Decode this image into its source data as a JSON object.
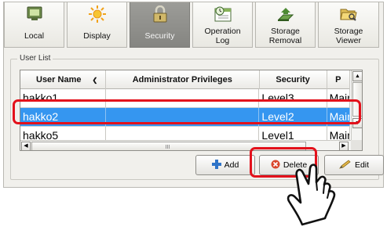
{
  "tabs": [
    {
      "label": "Local",
      "icon": "local-icon",
      "active": false
    },
    {
      "label": "Display",
      "icon": "sun-icon",
      "active": false
    },
    {
      "label": "Security",
      "icon": "lock-icon",
      "active": true
    },
    {
      "label": "Operation\nLog",
      "icon": "operation-log-icon",
      "active": false
    },
    {
      "label": "Storage\nRemoval",
      "icon": "storage-removal-icon",
      "active": false
    },
    {
      "label": "Storage\nViewer",
      "icon": "folder-icon",
      "active": false
    }
  ],
  "user_list": {
    "title": "User List",
    "columns": [
      "User Name",
      "Administrator Privileges",
      "Security",
      "P"
    ],
    "rows": [
      {
        "user": "hakko1",
        "admin": "",
        "security": "Level3",
        "extra": "Main"
      },
      {
        "user": "hakko2",
        "admin": "",
        "security": "Level2",
        "extra": "Main",
        "selected": true
      },
      {
        "user": "hakko5",
        "admin": "",
        "security": "Level1",
        "extra": "Main"
      }
    ]
  },
  "buttons": {
    "add": "Add",
    "delete": "Delete",
    "edit": "Edit"
  },
  "colors": {
    "selection": "#3596f0",
    "highlight": "#e3111b",
    "active_tab": "#8f8f8b"
  }
}
